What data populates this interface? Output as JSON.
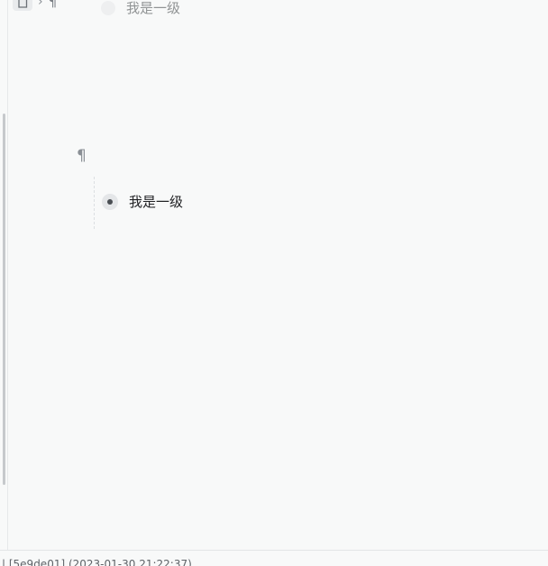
{
  "breadcrumb": {
    "doc_icon": "document-icon",
    "separator": "›",
    "paragraph_symbol": "¶"
  },
  "editor": {
    "ghost_item_text": "我是一级",
    "paragraph_symbol": "¶",
    "list_item_text": "我是一级"
  },
  "status_bar": {
    "text": "| [5e9de01] (2023-01-30 21:22:37)"
  },
  "colors": {
    "background": "#f8f9f9",
    "bullet_bg": "#e4e6e8",
    "bullet_dot": "#4a4e53",
    "muted_text": "#8a8f95"
  }
}
